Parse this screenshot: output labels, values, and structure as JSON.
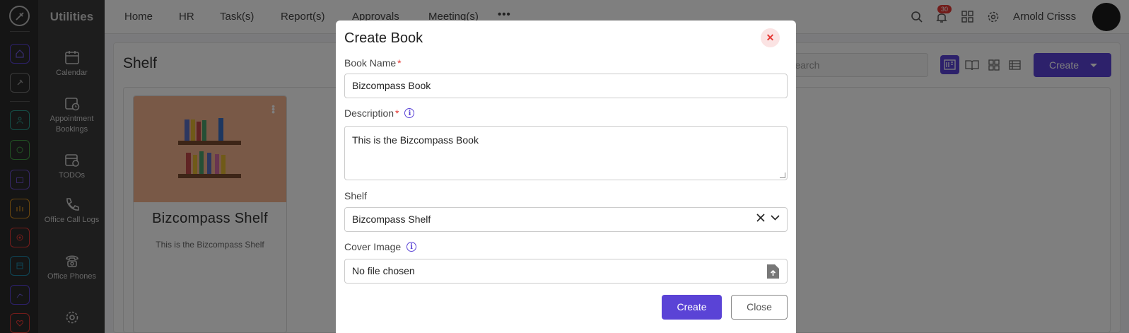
{
  "app": {
    "section_name": "Utilities"
  },
  "topbar": {
    "nav": [
      "Home",
      "HR",
      "Task(s)",
      "Report(s)",
      "Approvals",
      "Meeting(s)"
    ],
    "notification_count": "30",
    "user_name": "Arnold Crisss"
  },
  "sidebar": {
    "items": [
      {
        "label": "Calendar",
        "icon": "calendar-icon"
      },
      {
        "label": "Appointment Bookings",
        "icon": "calendar-clock-icon"
      },
      {
        "label": "TODOs",
        "icon": "todo-calendar-icon"
      },
      {
        "label": "Office Call Logs",
        "icon": "phone-icon"
      },
      {
        "label": "Office Phones",
        "icon": "desk-phone-icon"
      },
      {
        "label": "",
        "icon": "gear-icon"
      }
    ]
  },
  "page": {
    "title": "Shelf",
    "search_placeholder": "Search",
    "create_label": "Create"
  },
  "shelf_card": {
    "title": "Bizcompass Shelf",
    "description": "This is the Bizcompass Shelf"
  },
  "modal": {
    "title": "Create Book",
    "book_name_label": "Book Name",
    "book_name_value": "Bizcompass Book",
    "description_label": "Description",
    "description_value": "This is the Bizcompass Book",
    "shelf_label": "Shelf",
    "shelf_value": "Bizcompass Shelf",
    "cover_label": "Cover Image",
    "cover_value": "No file chosen",
    "required_mark": "*",
    "create_button": "Create",
    "close_button": "Close"
  },
  "colors": {
    "accent": "#5a43d6",
    "danger": "#e53935",
    "cover_bg": "#f2b38f"
  }
}
